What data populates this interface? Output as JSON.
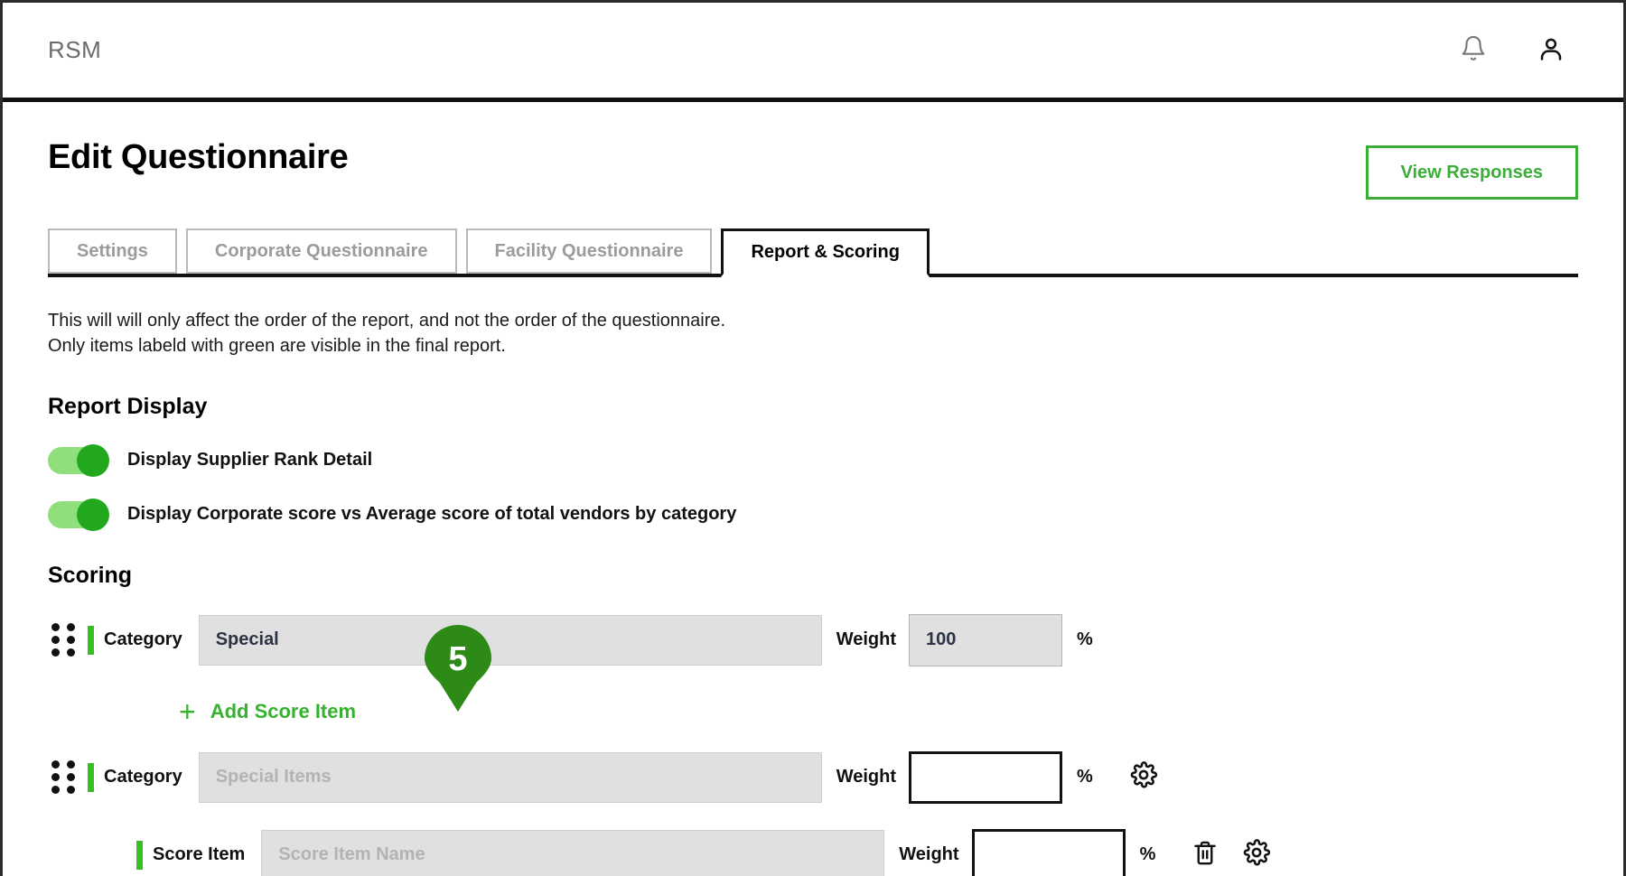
{
  "header": {
    "brand": "RSM",
    "notifications_icon": "bell-icon",
    "account_icon": "person-icon"
  },
  "page": {
    "title": "Edit Questionnaire",
    "view_responses_label": "View Responses"
  },
  "tabs": [
    {
      "label": "Settings",
      "active": false
    },
    {
      "label": "Corporate Questionnaire",
      "active": false
    },
    {
      "label": "Facility Questionnaire",
      "active": false
    },
    {
      "label": "Report & Scoring",
      "active": true
    }
  ],
  "notes": {
    "line1": "This will will only affect the order of the report, and not the order of the questionnaire.",
    "line2": "Only items labeld with green are visible in the final report."
  },
  "report_display": {
    "section_title": "Report Display",
    "toggles": [
      {
        "label": "Display Supplier Rank Detail",
        "on": true
      },
      {
        "label": "Display Corporate score vs Average score of total vendors by category",
        "on": true
      }
    ]
  },
  "scoring": {
    "section_title": "Scoring",
    "weight_label": "Weight",
    "percent_symbol": "%",
    "add_item_label": "Add Score Item",
    "rows": [
      {
        "type_label": "Category",
        "name_value": "Special",
        "name_placeholder": "",
        "weight_value": "100",
        "weight_placeholder": ""
      },
      {
        "type_label": "Category",
        "name_value": "",
        "name_placeholder": "Special Items",
        "weight_value": "",
        "weight_placeholder": ""
      },
      {
        "type_label": "Score Item",
        "name_value": "",
        "name_placeholder": "Score Item Name",
        "weight_value": "",
        "weight_placeholder": ""
      }
    ]
  },
  "annotation": {
    "marker_number": "5"
  },
  "colors": {
    "brand_green": "#3aae38",
    "accent_green": "#35c120",
    "toggle_track": "#90df7d",
    "toggle_knob": "#22a81f",
    "pin_green": "#2d8a16",
    "input_gray": "#e0e0e0",
    "text_dark": "#111111",
    "muted": "#9b9b9b"
  }
}
